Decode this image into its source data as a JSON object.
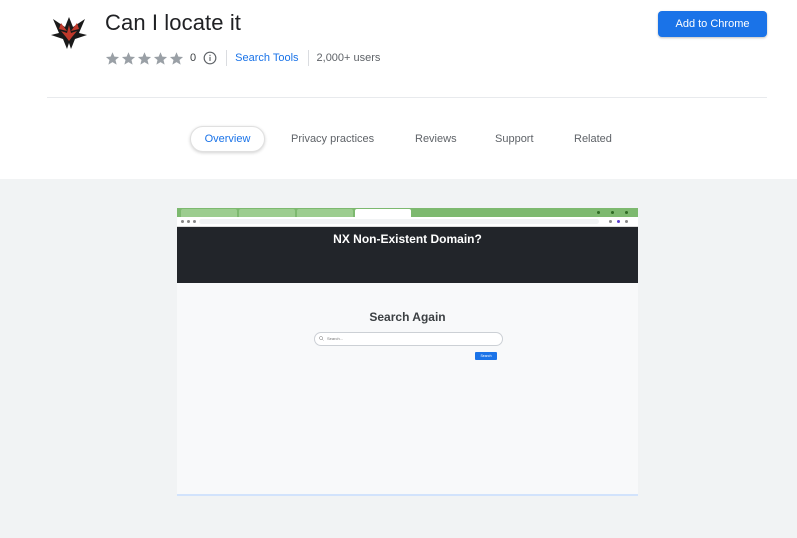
{
  "header": {
    "title": "Can I locate it",
    "rating": "0",
    "category": "Search Tools",
    "users": "2,000+ users",
    "add_button": "Add to Chrome",
    "star_color": "#9aa0a6",
    "logo_colors": [
      "#1a1a1a",
      "#c0392b"
    ]
  },
  "tabs": [
    {
      "label": "Overview",
      "active": true
    },
    {
      "label": "Privacy practices",
      "active": false
    },
    {
      "label": "Reviews",
      "active": false
    },
    {
      "label": "Support",
      "active": false
    },
    {
      "label": "Related",
      "active": false
    }
  ],
  "screenshot": {
    "browser_tabs": [
      "",
      "",
      "",
      ""
    ],
    "address": "",
    "banner_title": "NX Non-Existent Domain?",
    "search_title": "Search Again",
    "search_placeholder": "Search...",
    "search_button": "Search"
  },
  "colors": {
    "accent": "#1a73e8",
    "gallery_bg": "#f1f3f4",
    "banner_bg": "#22252a",
    "tabbar": "#7db96f"
  }
}
